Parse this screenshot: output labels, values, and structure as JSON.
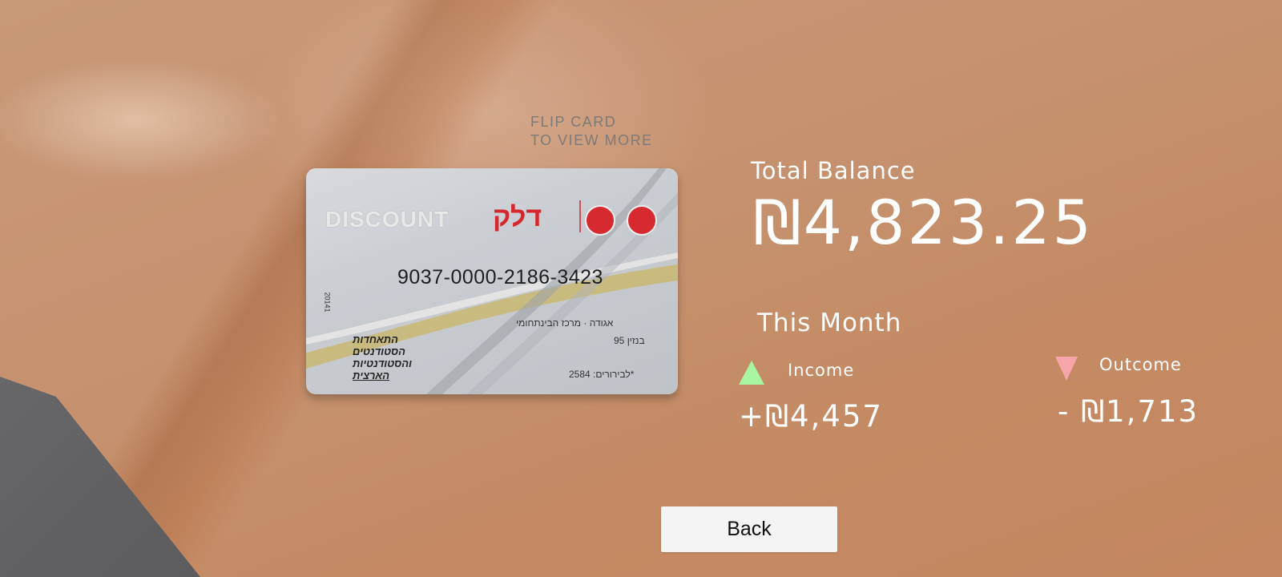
{
  "hint": {
    "line1": "FLIP CARD",
    "line2": "TO VIEW MORE"
  },
  "card": {
    "brand": "DISCOUNT",
    "brand_hebrew": "דלק",
    "number": "9037-0000-2186-3423",
    "side_code": "20141",
    "detail_line1": "אגודה · מרכז הבינתחומי",
    "detail_line2": "בנזין 95",
    "detail_line3": "לבירורים: 2584*",
    "org_line1": "התאחדות",
    "org_line2": "הסטודנטים",
    "org_line3": "והסטודנטיות",
    "org_line4": "הארצית"
  },
  "balance": {
    "label": "Total Balance",
    "value": "₪4,823.25"
  },
  "month": {
    "label": "This Month",
    "income_label": "Income",
    "income_value": "+₪4,457",
    "outcome_label": "Outcome",
    "outcome_value": "- ₪1,713",
    "income_color": "#a8f5a2",
    "outcome_color": "#f6a5a8"
  },
  "actions": {
    "back_label": "Back"
  }
}
